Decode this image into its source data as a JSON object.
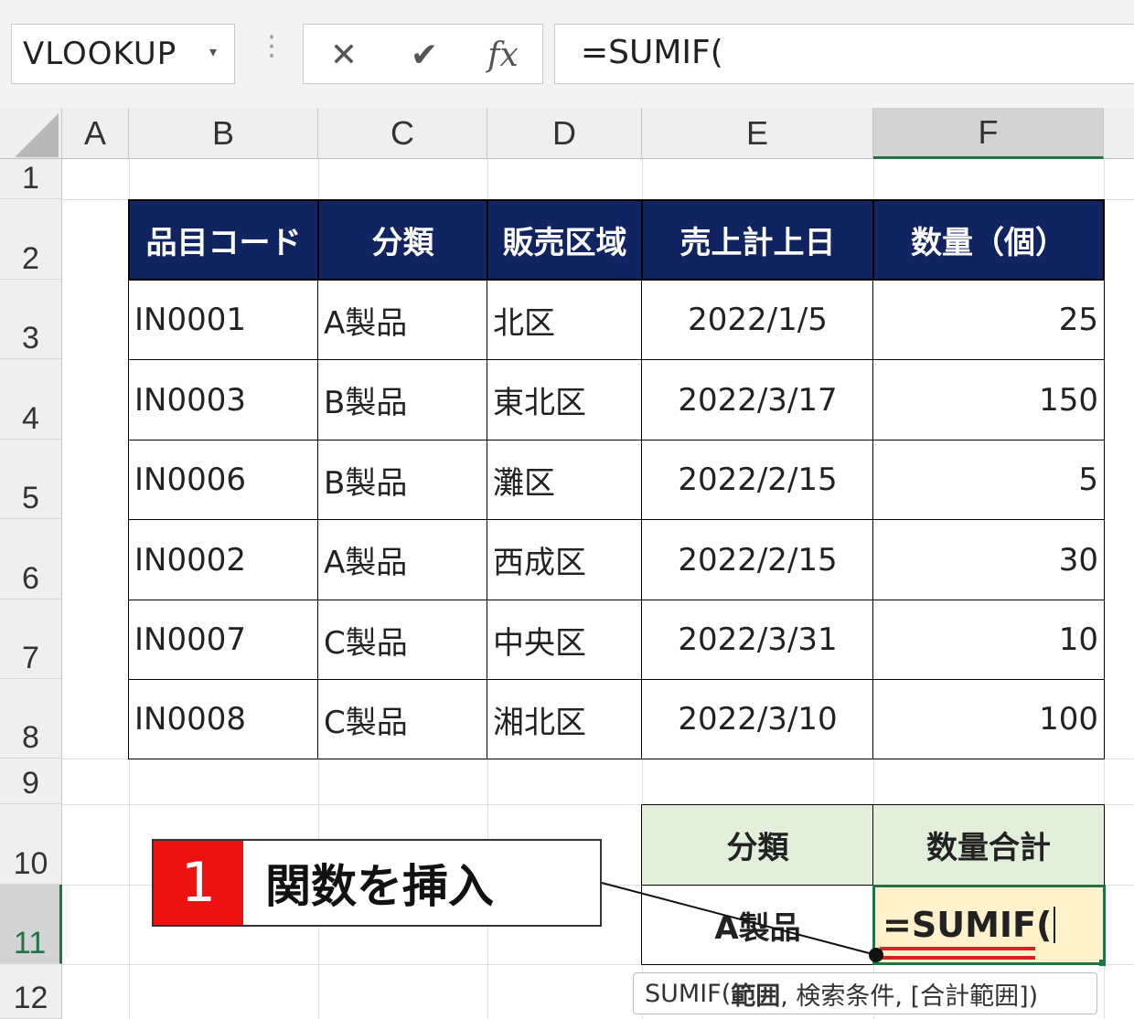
{
  "formula_bar": {
    "name_box": "VLOOKUP",
    "name_box_arrow_icon": "chevron-down-icon",
    "cancel_icon": "✕",
    "enter_icon": "✔",
    "fx_label": "fx",
    "formula": "=SUMIF("
  },
  "columns": [
    "A",
    "B",
    "C",
    "D",
    "E",
    "F"
  ],
  "rows": [
    "1",
    "2",
    "3",
    "4",
    "5",
    "6",
    "7",
    "8",
    "9",
    "10",
    "11",
    "12"
  ],
  "table": {
    "headers": [
      "品目コード",
      "分類",
      "販売区域",
      "売上計上日",
      "数量（個）"
    ],
    "rows": [
      [
        "IN0001",
        "A製品",
        "北区",
        "2022/1/5",
        "25"
      ],
      [
        "IN0003",
        "B製品",
        "東北区",
        "2022/3/17",
        "150"
      ],
      [
        "IN0006",
        "B製品",
        "灘区",
        "2022/2/15",
        "5"
      ],
      [
        "IN0002",
        "A製品",
        "西成区",
        "2022/2/15",
        "30"
      ],
      [
        "IN0007",
        "C製品",
        "中央区",
        "2022/3/31",
        "10"
      ],
      [
        "IN0008",
        "C製品",
        "湘北区",
        "2022/3/10",
        "100"
      ]
    ],
    "header_color": "#0f2460"
  },
  "summary": {
    "header_category": "分類",
    "header_total": "数量合計",
    "category_value": "A製品",
    "formula_input": "=SUMIF(",
    "header_color": "#e2efda",
    "active_color": "#fff2cc"
  },
  "callout": {
    "number": "1",
    "text": "関数を挿入",
    "number_color": "#ee1111"
  },
  "tooltip": {
    "prefix": "SUMIF(",
    "bold_arg": "範囲",
    "rest": ", 検索条件, [合計範囲])"
  }
}
